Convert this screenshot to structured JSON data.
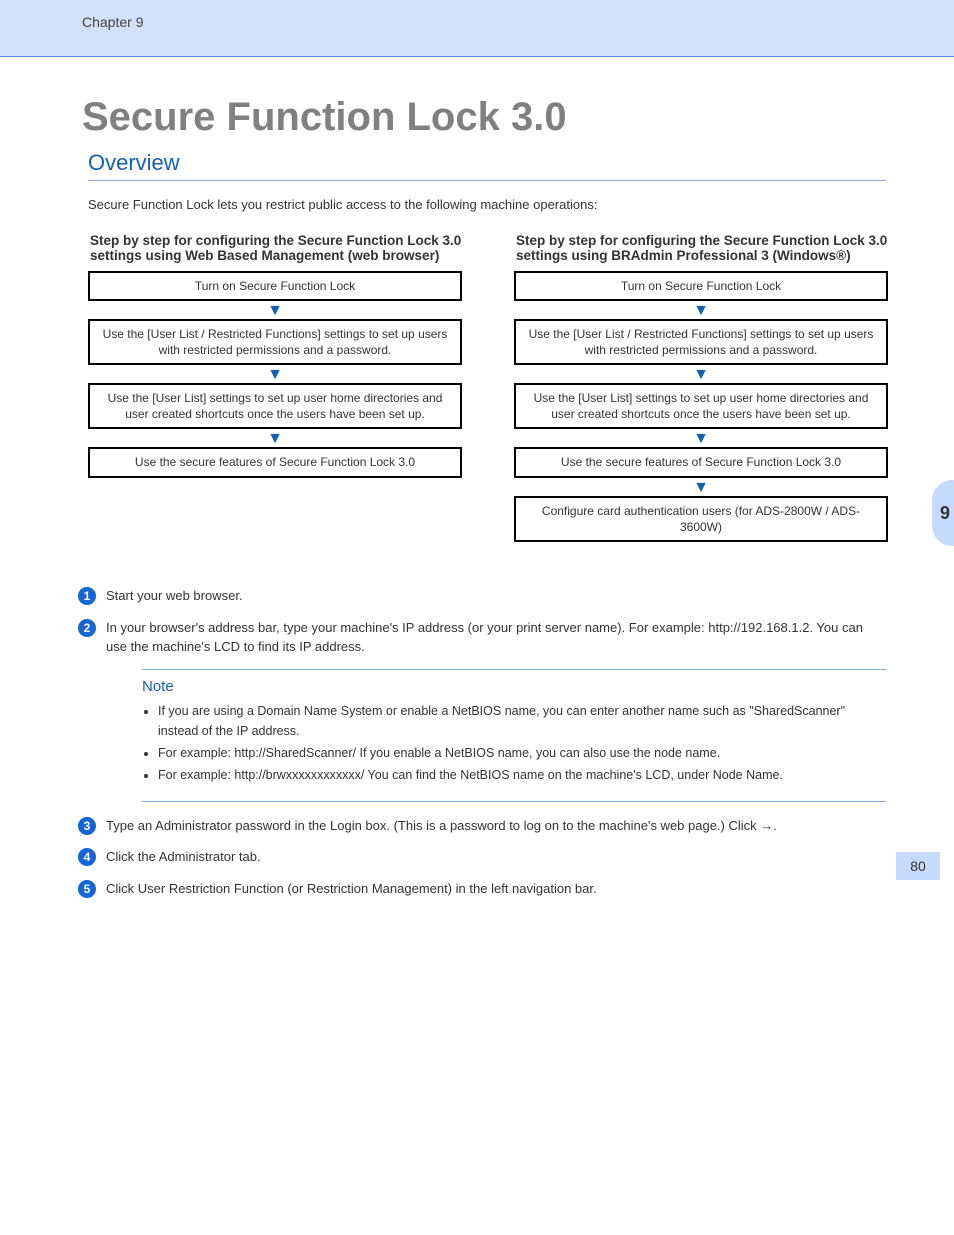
{
  "chapter": "Chapter 9",
  "title": "Secure Function Lock 3.0",
  "overview_heading": "Overview",
  "overview_text": "Secure Function Lock lets you restrict public access to the following machine operations:",
  "flows": {
    "left": {
      "caption": "Step by step for configuring the Secure Function Lock 3.0 settings using Web Based Management (web browser)",
      "steps": [
        "Turn on Secure Function Lock",
        "Use the [User List / Restricted Functions] settings to set up users with restricted permissions and a password.",
        "Use the [User List] settings to set up user home directories and user created shortcuts once the users have been set up.",
        "Use the secure features of Secure Function Lock 3.0"
      ]
    },
    "right": {
      "caption": "Step by step for configuring the Secure Function Lock 3.0 settings using BRAdmin Professional 3 (Windows®)",
      "steps": [
        "Turn on Secure Function Lock",
        "Use the [User List / Restricted Functions] settings to set up users with restricted permissions and a password.",
        "Use the [User List] settings to set up user home directories and user created shortcuts once the users have been set up.",
        "Use the secure features of Secure Function Lock 3.0",
        "Configure card authentication users (for ADS-2800W / ADS-3600W)"
      ]
    }
  },
  "steps": [
    {
      "n": "1",
      "text": "Start your web browser."
    },
    {
      "n": "2",
      "text": "In your browser's address bar, type your machine's IP address (or your print server name). For example: http://192.168.1.2. You can use the machine's LCD to find its IP address."
    },
    {
      "n": "3",
      "text": "Type an Administrator password in the Login box. (This is a password to log on to the machine's web page.) Click →."
    },
    {
      "n": "4",
      "text": "Click the Administrator tab."
    },
    {
      "n": "5",
      "text": "Click User Restriction Function (or Restriction Management) in the left navigation bar."
    }
  ],
  "notebox": {
    "title": "Note",
    "items": [
      "If you are using a Domain Name System or enable a NetBIOS name, you can enter another name such as \"SharedScanner\" instead of the IP address.",
      "For example: http://SharedScanner/  If you enable a NetBIOS name, you can also use the node name.",
      "For example: http://brwxxxxxxxxxxxx/  You can find the NetBIOS name on the machine's LCD, under Node Name."
    ]
  },
  "sidetab": "9",
  "page_number": "80"
}
